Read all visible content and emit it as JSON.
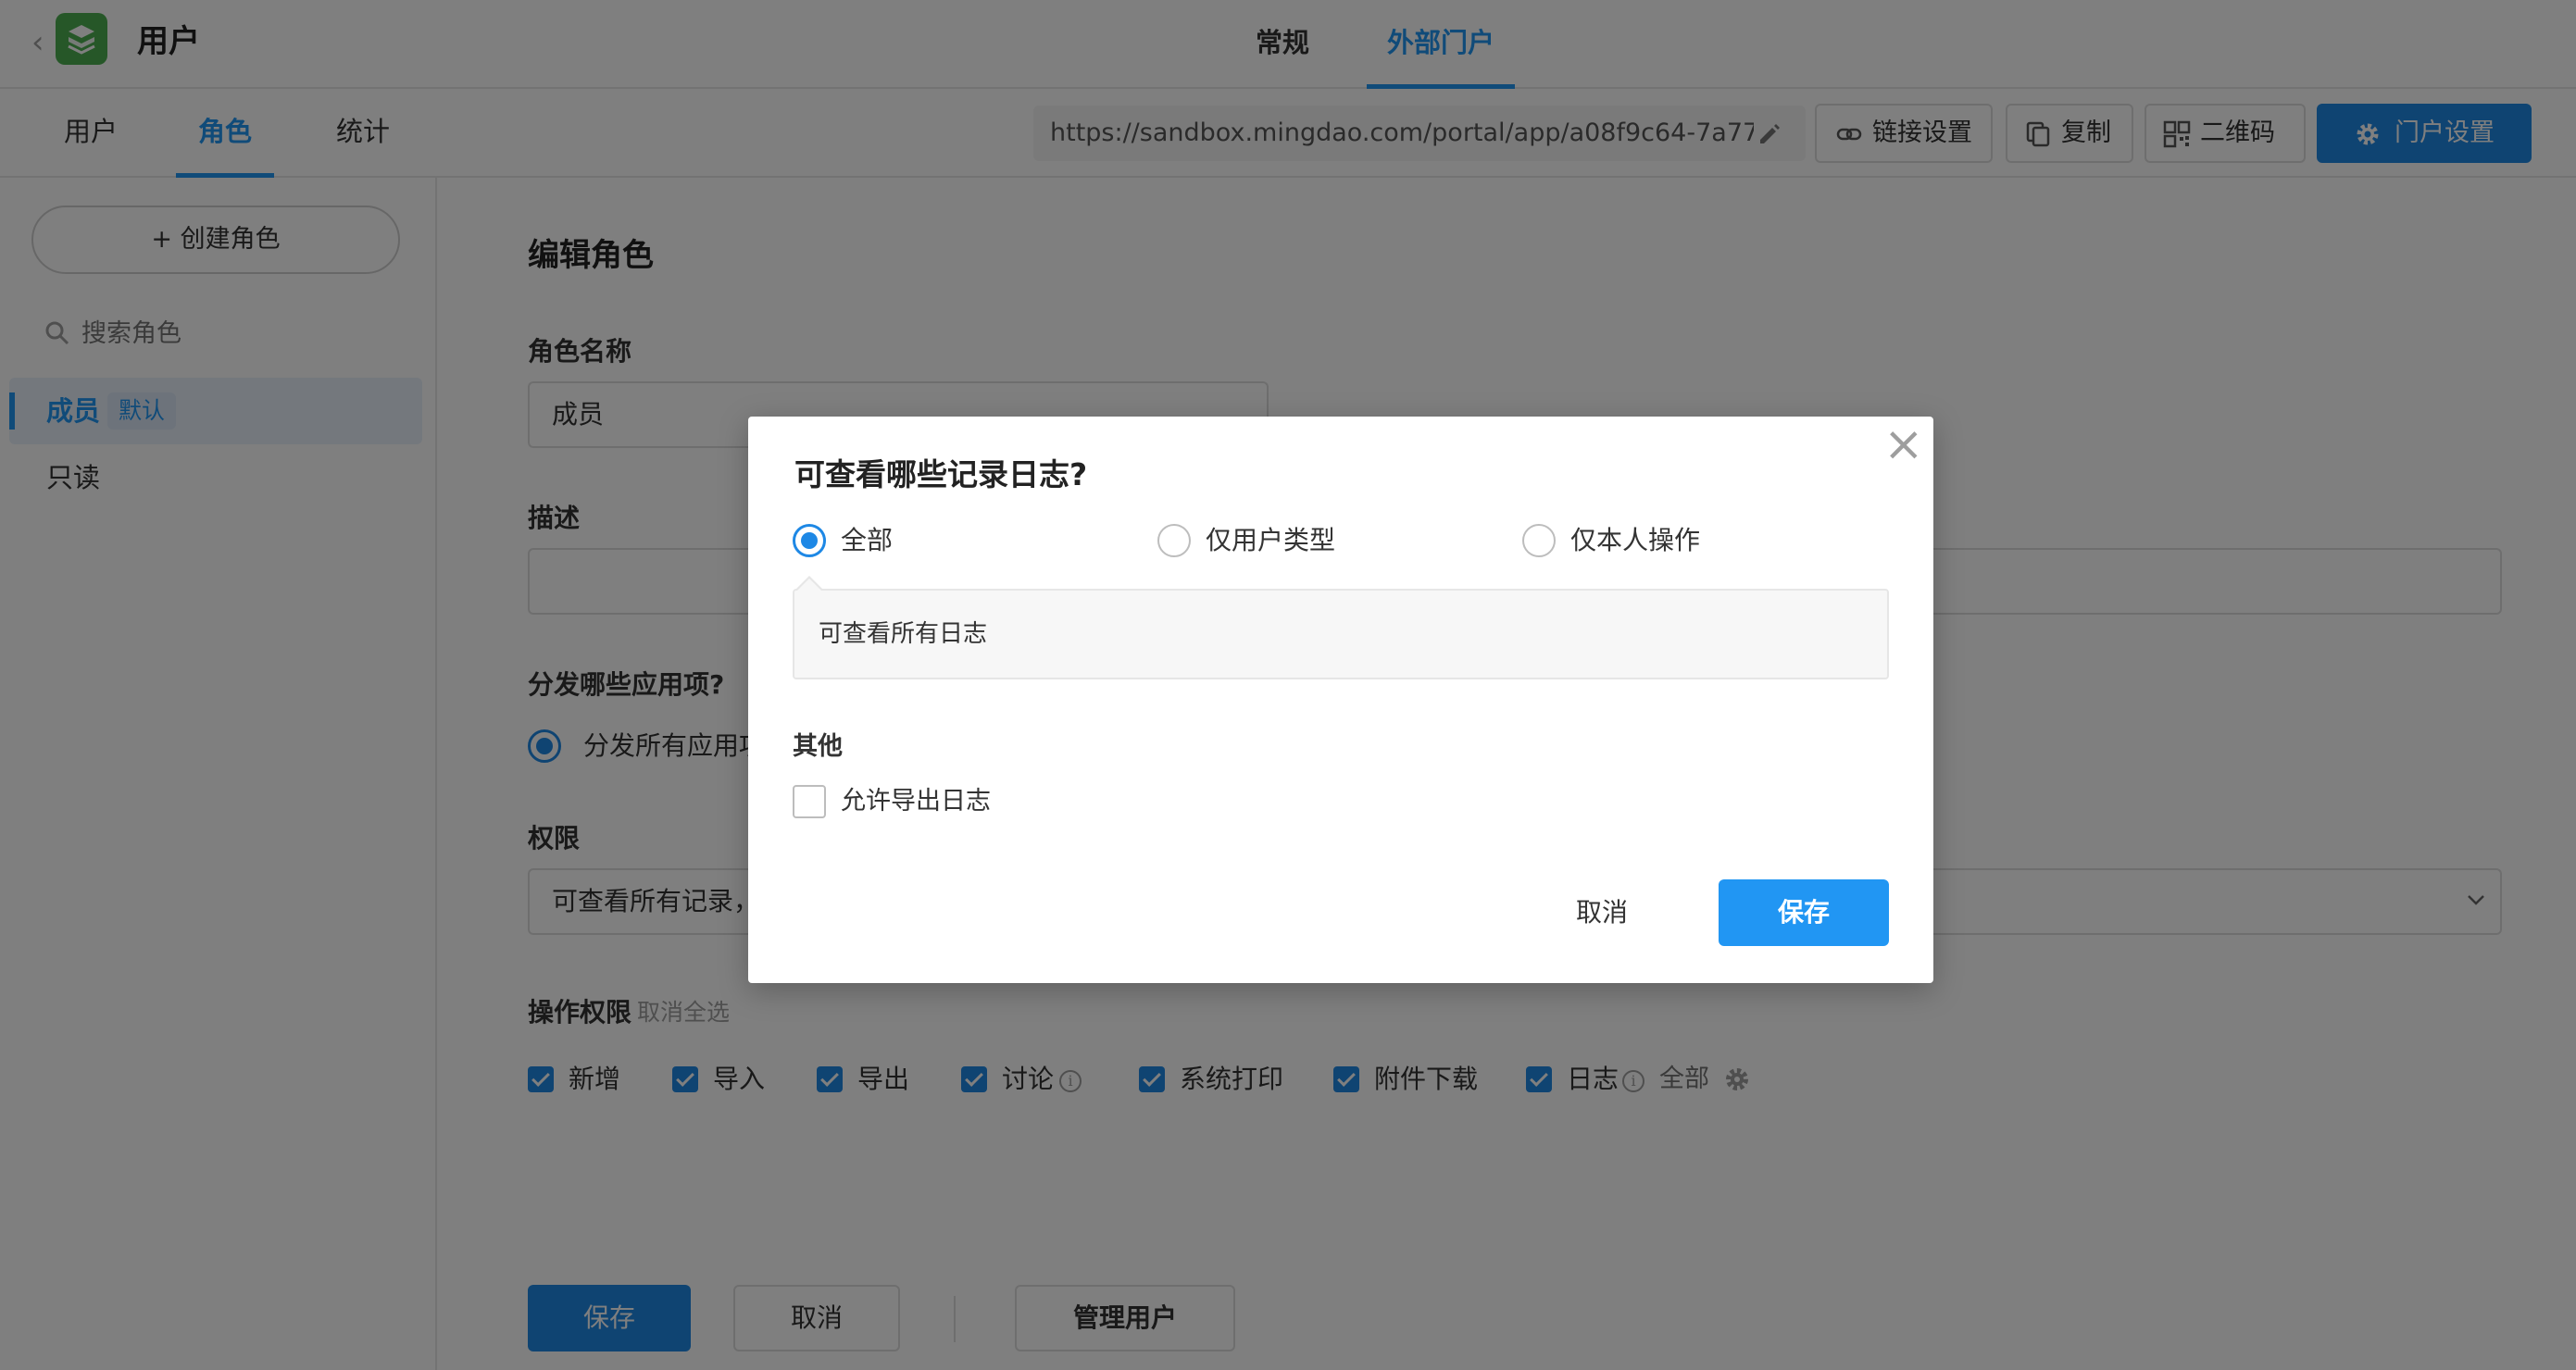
{
  "header": {
    "back_glyph": "‹",
    "app_title": "用户",
    "tabs": [
      {
        "label": "常规"
      },
      {
        "label": "外部门户"
      }
    ]
  },
  "subnav": {
    "tabs": [
      {
        "label": "用户"
      },
      {
        "label": "角色"
      },
      {
        "label": "统计"
      }
    ],
    "portal_url": "https://sandbox.mingdao.com/portal/app/a08f9c64-7a77-...",
    "buttons": {
      "link_settings": "链接设置",
      "copy": "复制",
      "qrcode": "二维码",
      "portal_settings": "门户设置"
    }
  },
  "sidebar": {
    "create_role": "+ 创建角色",
    "search_placeholder": "搜索角色",
    "roles": [
      {
        "name": "成员",
        "badge": "默认"
      },
      {
        "name": "只读"
      }
    ]
  },
  "main": {
    "title": "编辑角色",
    "role_name_label": "角色名称",
    "role_name_value": "成员",
    "desc_label": "描述",
    "distribute_label": "分发哪些应用项?",
    "distribute_option": "分发所有应用项",
    "perm_label": "权限",
    "perm_value": "可查看所有记录，",
    "op_perm_label": "操作权限",
    "deselect_all": "取消全选",
    "operations": [
      "新增",
      "导入",
      "导出",
      "讨论",
      "系统打印",
      "附件下载",
      "日志"
    ],
    "info_glyph": "i",
    "log_scope": "全部",
    "buttons": {
      "save": "保存",
      "cancel": "取消",
      "manage_users": "管理用户"
    }
  },
  "modal": {
    "title": "可查看哪些记录日志?",
    "close_glyph": "×",
    "options": [
      {
        "label": "全部",
        "selected": true
      },
      {
        "label": "仅用户类型",
        "selected": false
      },
      {
        "label": "仅本人操作",
        "selected": false
      }
    ],
    "scope_description": "可查看所有日志",
    "other_label": "其他",
    "allow_export_label": "允许导出日志",
    "allow_export_checked": false,
    "cancel": "取消",
    "save": "保存"
  },
  "colors": {
    "accent": "#2196f3",
    "primary_button": "#1e88e5",
    "app_logo": "#4caf50",
    "overlay": "rgba(0,0,0,0.5)"
  },
  "icons": [
    "back-chevron-icon",
    "app-logo-icon",
    "edit-pencil-icon",
    "link-icon",
    "copy-icon",
    "qrcode-icon",
    "gear-icon",
    "search-icon",
    "info-icon",
    "chevron-down-icon",
    "close-icon"
  ]
}
